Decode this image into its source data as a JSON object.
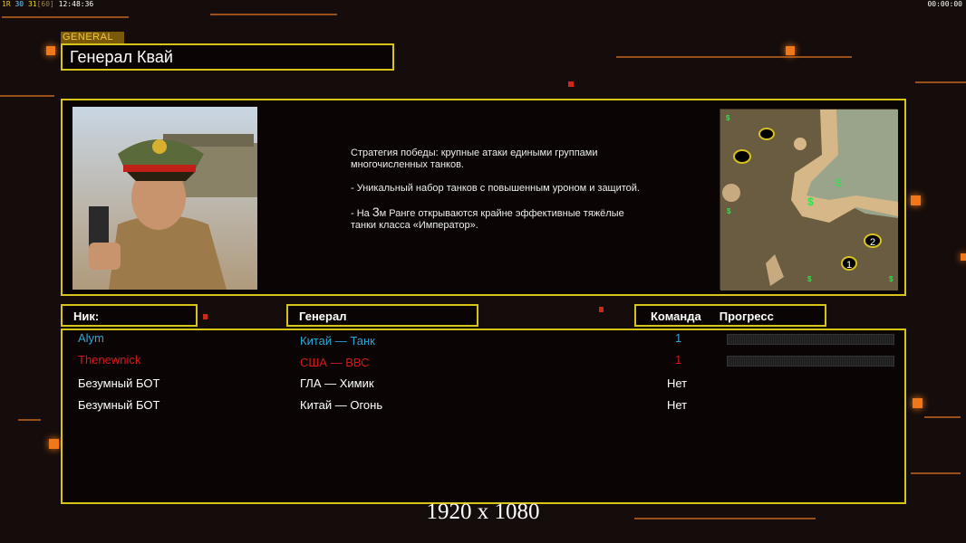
{
  "hud": {
    "stats_fps": "1R",
    "stats_a": "30",
    "stats_b": "31",
    "stats_c": "[60]",
    "time": "12:48:36",
    "timer": "00:00:00"
  },
  "general": {
    "tag": "GENERAL",
    "name": "Генерал Квай"
  },
  "description": {
    "line1": "Стратегия победы: крупные атаки едиными группами многочисленных танков.",
    "line2": "- Уникальный набор танков с повышенным уроном и защитой.",
    "line3_pre": "- На ",
    "line3_num": "3",
    "line3_post": "м Ранге открываются крайне эффективные тяжёлые танки класса «Император»."
  },
  "minimap": {
    "start1": "1",
    "start2": "2",
    "supply": "$"
  },
  "headers": {
    "nick": "Ник:",
    "general": "Генерал",
    "team": "Команда",
    "progress": "Прогресс"
  },
  "players": [
    {
      "nick": "Alym",
      "general": "Китай — Танк",
      "team": "1",
      "color": "#2aa8d8",
      "progress": 0
    },
    {
      "nick": "Thenewnick",
      "general": "США — ВВС",
      "team": "1",
      "color": "#d81818",
      "progress": 0
    },
    {
      "nick": "Безумный БОТ",
      "general": "ГЛА — Химик",
      "team": "Нет",
      "color": "#ffffff"
    },
    {
      "nick": "Безумный БОТ",
      "general": "Китай — Огонь",
      "team": "Нет",
      "color": "#ffffff"
    }
  ],
  "resolution": "1920 x 1080"
}
